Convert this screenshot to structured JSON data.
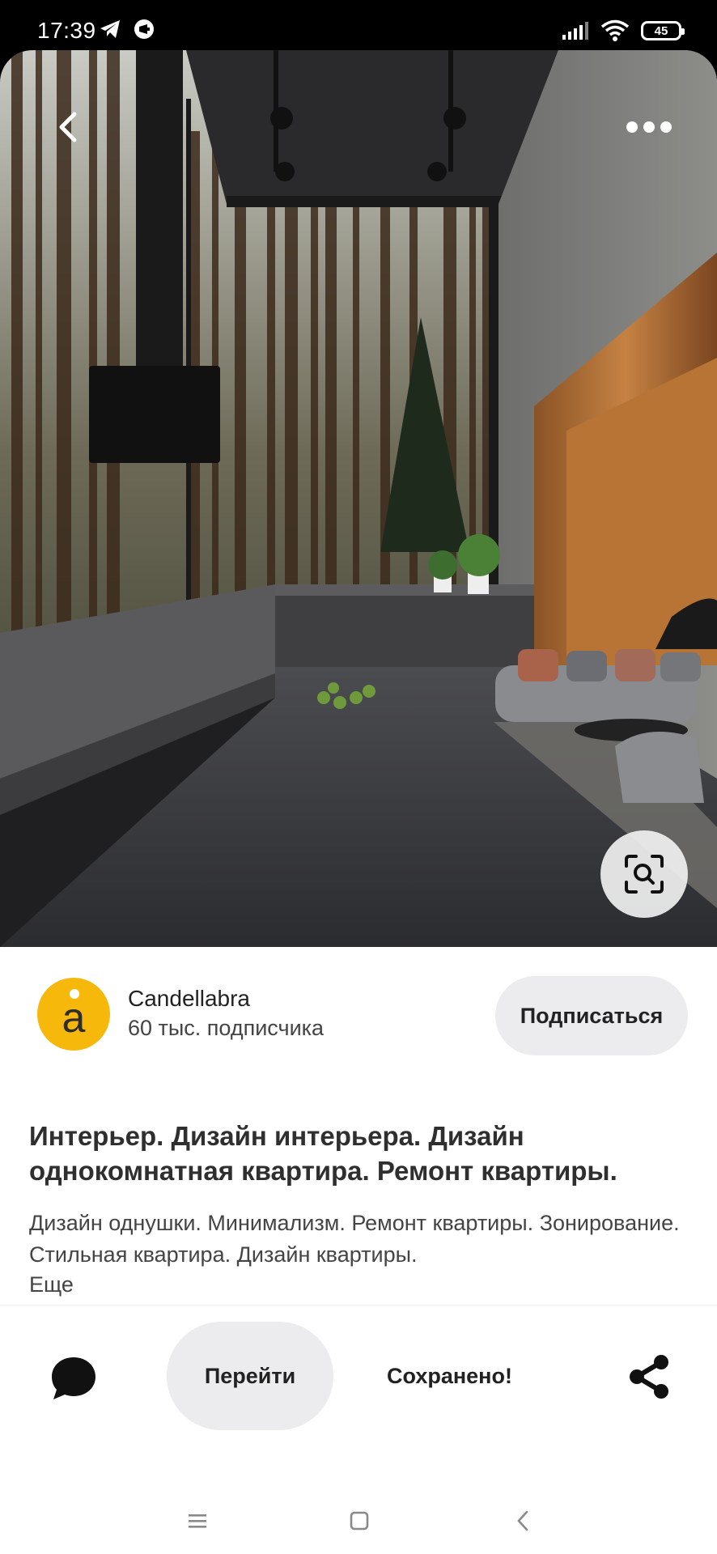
{
  "status_bar": {
    "time": "17:39",
    "left_icons": [
      "telegram-icon",
      "app-notification-icon"
    ],
    "right_icons": [
      "signal-icon",
      "wifi-icon",
      "battery-icon"
    ],
    "battery_level": "45"
  },
  "pin": {
    "image_alt": "Dark modern interior with floor-to-ceiling windows overlooking a pine forest, black kitchen and grey sofa",
    "back_icon": "chevron-left-icon",
    "more_icon": "more-horizontal-icon",
    "lens_icon": "visual-search-icon"
  },
  "profile": {
    "avatar_letter": "a",
    "avatar_color": "#f7b80c",
    "name": "Candellabra",
    "followers": "60 тыс. подписчика",
    "subscribe_label": "Подписаться"
  },
  "description": {
    "title": "Интерьер. Дизайн интерьера. Дизайн однокомнатная квартира. Ремонт квартиры.",
    "text": "Дизайн однушки. Минимализм. Ремонт квартиры. Зонирование. Стильная квартира. Дизайн квартиры.",
    "more_label": "Еще"
  },
  "actions": {
    "comment_icon": "comment-icon",
    "go_label": "Перейти",
    "saved_label": "Сохранено!",
    "share_icon": "share-icon"
  },
  "nav": {
    "menu_icon": "menu-icon",
    "home_icon": "home-square-icon",
    "back_icon": "nav-back-icon"
  }
}
